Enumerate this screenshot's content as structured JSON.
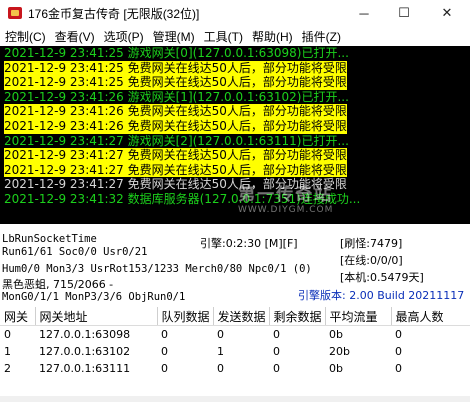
{
  "window": {
    "title": "176金币复古传奇 [无限版(32位)]",
    "minimize_icon": "─",
    "maximize_icon": "☐",
    "close_icon": "✕"
  },
  "menu": [
    "控制(C)",
    "查看(V)",
    "选项(P)",
    "管理(M)",
    "工具(T)",
    "帮助(H)",
    "插件(Z)"
  ],
  "log_lines": [
    {
      "style": "green",
      "text": "2021-12-9 23:41:25 游戏网关[0](127.0.0.1:63098)已打开..."
    },
    {
      "style": "yellow",
      "text": "2021-12-9 23:41:25 免费网关在线达50人后，部分功能将受限"
    },
    {
      "style": "yellow",
      "text": "2021-12-9 23:41:25 免费网关在线达50人后，部分功能将受限"
    },
    {
      "style": "green",
      "text": "2021-12-9 23:41:26 游戏网关[1](127.0.0.1:63102)已打开..."
    },
    {
      "style": "yellow",
      "text": "2021-12-9 23:41:26 免费网关在线达50人后，部分功能将受限"
    },
    {
      "style": "yellow",
      "text": "2021-12-9 23:41:26 免费网关在线达50人后，部分功能将受限"
    },
    {
      "style": "green",
      "text": "2021-12-9 23:41:27 游戏网关[2](127.0.0.1:63111)已打开..."
    },
    {
      "style": "yellow",
      "text": "2021-12-9 23:41:27 免费网关在线达50人后，部分功能将受限"
    },
    {
      "style": "yellow",
      "text": "2021-12-9 23:41:27 免费网关在线达50人后，部分功能将受限"
    },
    {
      "style": "white",
      "text": "2021-12-9 23:41:27 免费网关在线达50人后，部分功能将受限"
    },
    {
      "style": "green",
      "text": "2021-12-9 23:41:32 数据库服务器(127.0.0.1:7351)连接成功..."
    }
  ],
  "watermark": {
    "main": "第一传奇站",
    "sub": "WWW.DIYGM.COM"
  },
  "status": {
    "socket_time": "LbRunSocketTime",
    "engine": "引擎:0:2:30 [M][F]",
    "refresh": "[刷怪:7479]",
    "run": "Run61/61 Soc0/0 Usr0/21",
    "online": "[在线:0/0/0]",
    "hum": "Hum0/0 Mon3/3 UsrRot153/1233 Merch0/80 Npc0/1 (0)",
    "local": "[本机:0.5479天]",
    "monster": "黑色恶蛆, 715/2066 -",
    "engine_version": "引擎版本: 2.00 Build 20211117",
    "mon_go": "MonG0/1/1 MonP3/3/6 ObjRun0/1"
  },
  "gateway_table": {
    "headers": [
      "网关",
      "网关地址",
      "队列数据",
      "发送数据",
      "剩余数据",
      "平均流量",
      "最高人数"
    ],
    "rows": [
      [
        "0",
        "127.0.0.1:63098",
        "0",
        "0",
        "0",
        "0b",
        "0"
      ],
      [
        "1",
        "127.0.0.1:63102",
        "0",
        "1",
        "0",
        "20b",
        "0"
      ],
      [
        "2",
        "127.0.0.1:63111",
        "0",
        "0",
        "0",
        "0b",
        "0"
      ]
    ]
  },
  "colors": {
    "log_background": "#000000",
    "log_green": "#1cd11c",
    "log_highlight": "#ffff00",
    "version_blue": "#0a2fb8"
  }
}
